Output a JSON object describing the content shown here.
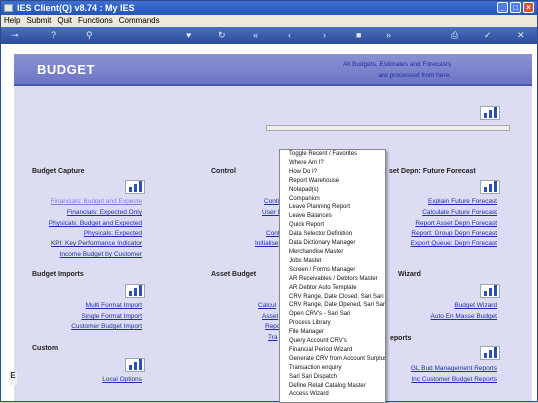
{
  "window": {
    "title": "IES Client(Q) v8.74 : My IES",
    "min": "_",
    "max": "□",
    "close": "×"
  },
  "menubar": [
    "Help",
    "Submit",
    "Quit",
    "Functions",
    "Commands"
  ],
  "toolbar": {
    "left_icon": "⊸",
    "help": "?",
    "search": "⚲",
    "heart": "♥",
    "refresh": "↻",
    "back": "«",
    "prev": "‹",
    "next": "›",
    "fwd": "»",
    "stop": "■",
    "print": "⎙",
    "ok": "✓",
    "x": "✕"
  },
  "page": {
    "title": "BUDGET",
    "info_line1": "All Budgets, Estimates and Forecasts",
    "info_line2": "are processed from here."
  },
  "sections": {
    "budget_capture": {
      "title": "Budget Capture",
      "links": [
        "Financials: Budget and Expecte",
        "Financials: Expected Only",
        "Physicals: Budget and Expected",
        "Physicals: Expected",
        "KPI: Key Performance Indicator",
        "Income Budget by Customer"
      ]
    },
    "control": {
      "title": "Control",
      "links": [
        "Conti",
        "User I",
        "",
        "Conti",
        "Initialise"
      ]
    },
    "asset_depn": {
      "title": "set Depn: Future Forecast",
      "links": [
        "Explain Future Forecast",
        "Calculate Future Forecast",
        "Report Asset Depn Forecast",
        "Report: Group Depn Forecast",
        "Export Queue: Depn Forecast"
      ]
    },
    "budget_imports": {
      "title": "Budget Imports",
      "links": [
        "Multi Format Import",
        "Single Format Import",
        "Customer Budget Import"
      ]
    },
    "asset_budget": {
      "title": "Asset Budget",
      "links": [
        "Calcul",
        "Asset",
        "Repo",
        "Tra"
      ]
    },
    "wizard": {
      "title": "Wizard",
      "links": [
        "Budget Wizard",
        "Auto En Masse Budget"
      ]
    },
    "custom": {
      "title": "Custom",
      "links": [
        "Local Options"
      ]
    },
    "reports": {
      "title": "eports",
      "links": [
        "GL Bud Management Reports",
        "Inc Customer Budget Reports"
      ]
    }
  },
  "sidebar_letter": "E",
  "context_menu": [
    "Toggle Recent / Favorites",
    "Where Am I?",
    "How Do I?",
    "Report Warehouse",
    "Notepad(s)",
    "Companion",
    "Leave Planning Report",
    "Leave Balances",
    "Quick Report",
    "Data Selector Definition",
    "Data Dictionary Manager",
    "Merchandise Master",
    "Jobs Master",
    "Screen / Forms Manager",
    "AR Receivables / Debtors Master",
    "AR Debtor Auto Template",
    "CRV Range, Date Closed, Sari Sari",
    "CRV Range, Date Opened, Sari Sari",
    "Open CRV's - Sari Sari",
    "Process Library",
    "File Manager",
    "Query Account CRV's",
    "Financial Period Wizard",
    "Generate CRV from Account Surplus",
    "Transaction enquiry",
    "Sari Sari Dispatch",
    "Define Retail Catalog Master",
    "Access Wizard"
  ]
}
